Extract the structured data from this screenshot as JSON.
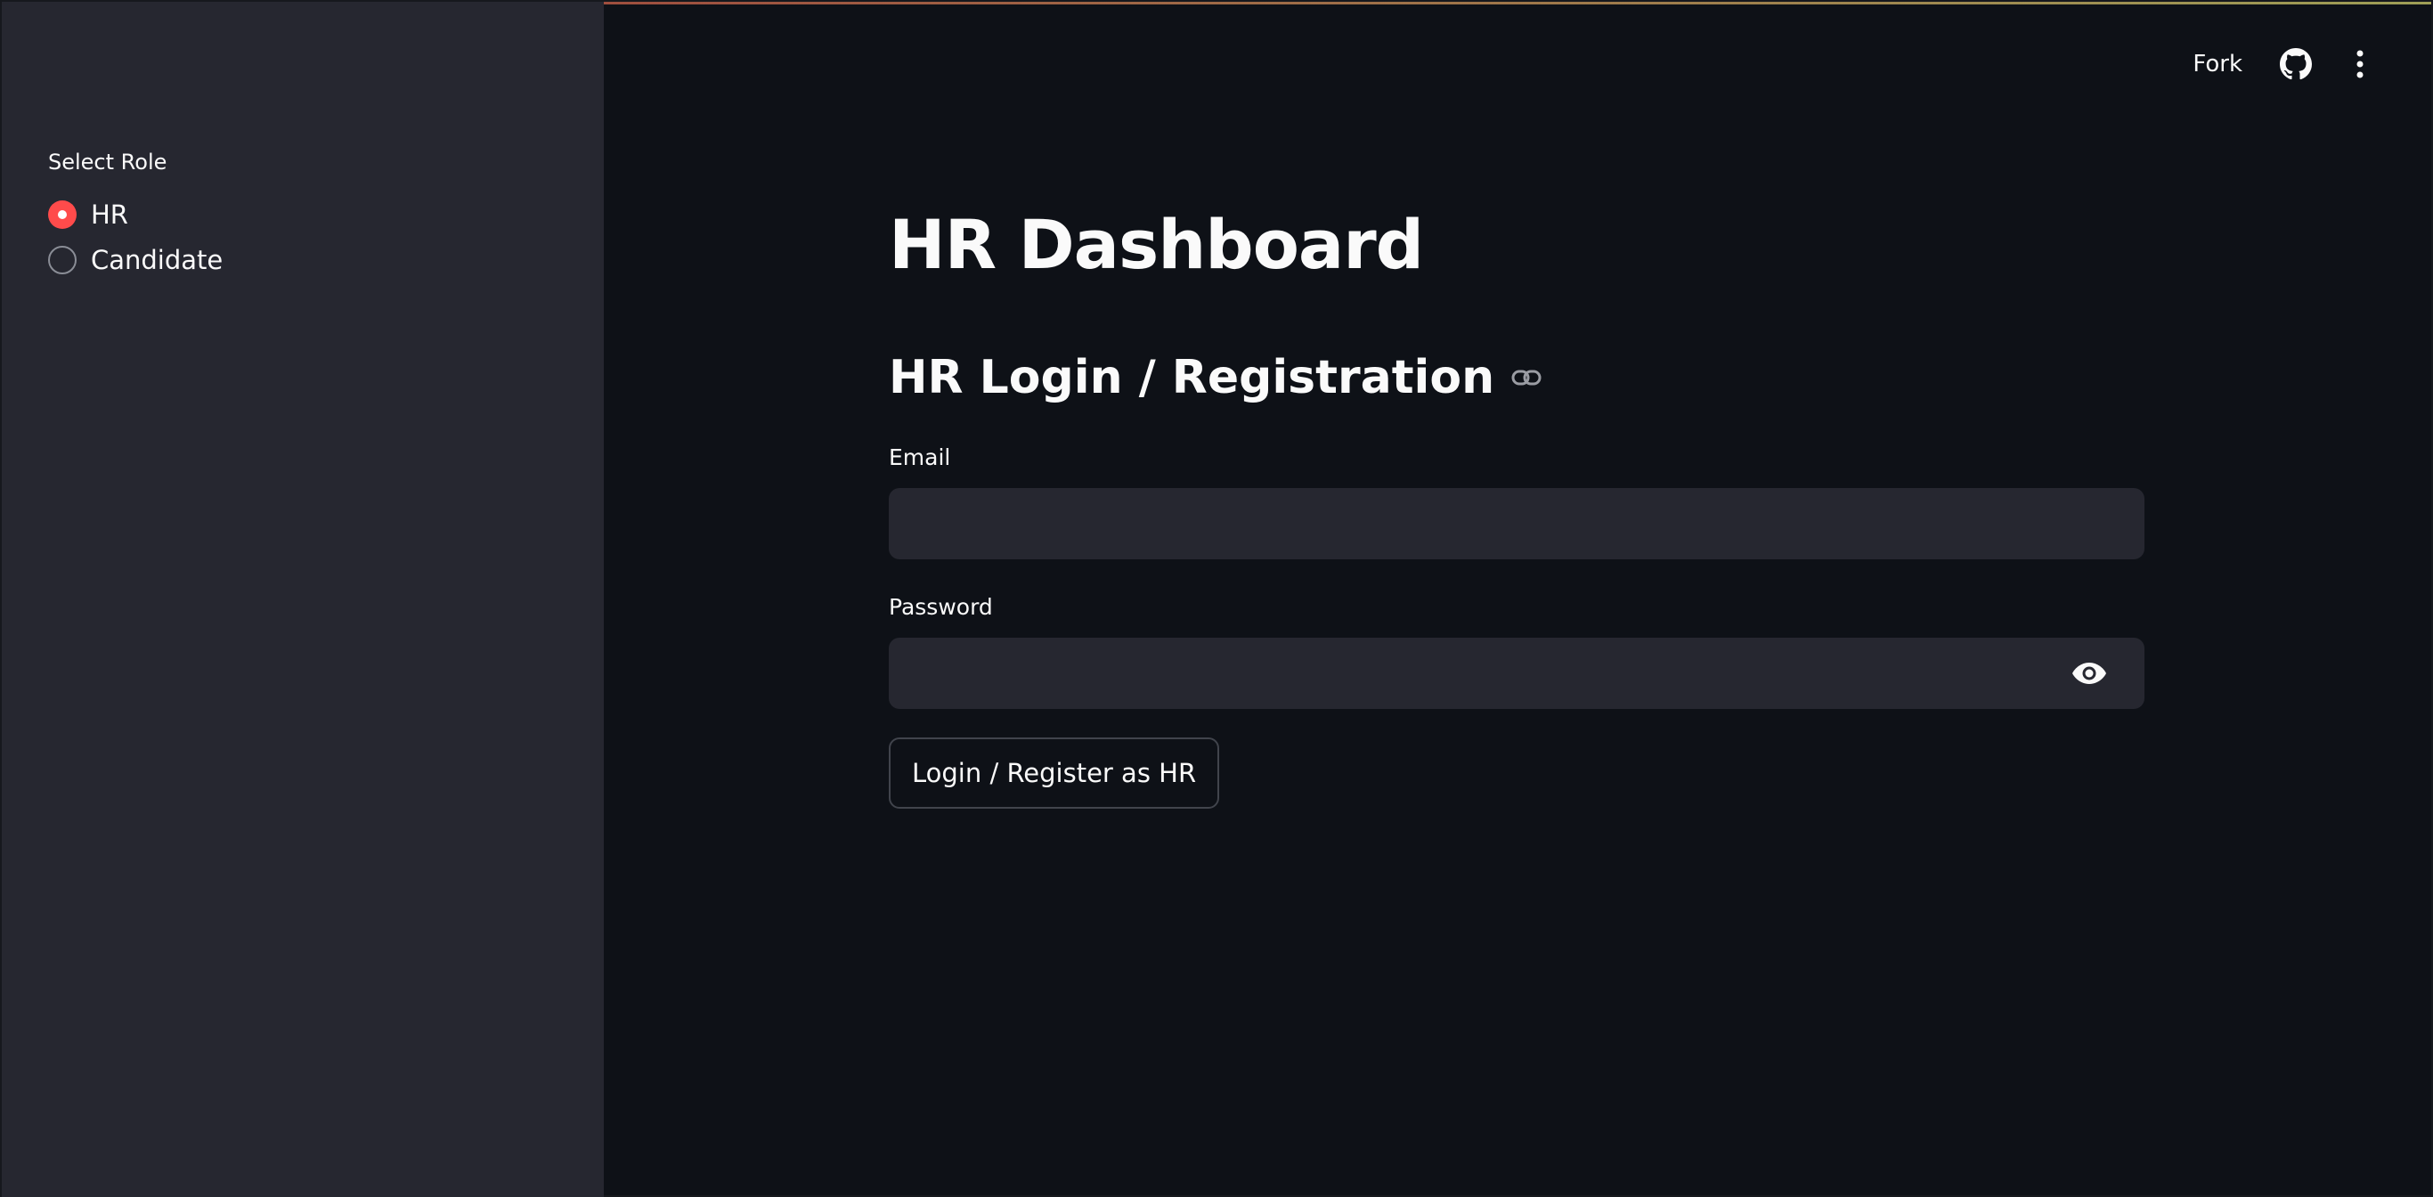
{
  "sidebar": {
    "role_label": "Select Role",
    "roles": [
      {
        "label": "HR",
        "selected": true
      },
      {
        "label": "Candidate",
        "selected": false
      }
    ]
  },
  "toolbar": {
    "fork_label": "Fork",
    "github_icon": "github-icon",
    "menu_icon": "kebab-menu-icon"
  },
  "main": {
    "title": "HR Dashboard",
    "section_title": "HR Login / Registration",
    "email_label": "Email",
    "email_value": "",
    "password_label": "Password",
    "password_value": "",
    "submit_label": "Login / Register as HR"
  },
  "colors": {
    "background": "#0e1117",
    "sidebar": "#262730",
    "input": "#262730",
    "accent": "#ff4b4b",
    "text": "#fafafa"
  }
}
